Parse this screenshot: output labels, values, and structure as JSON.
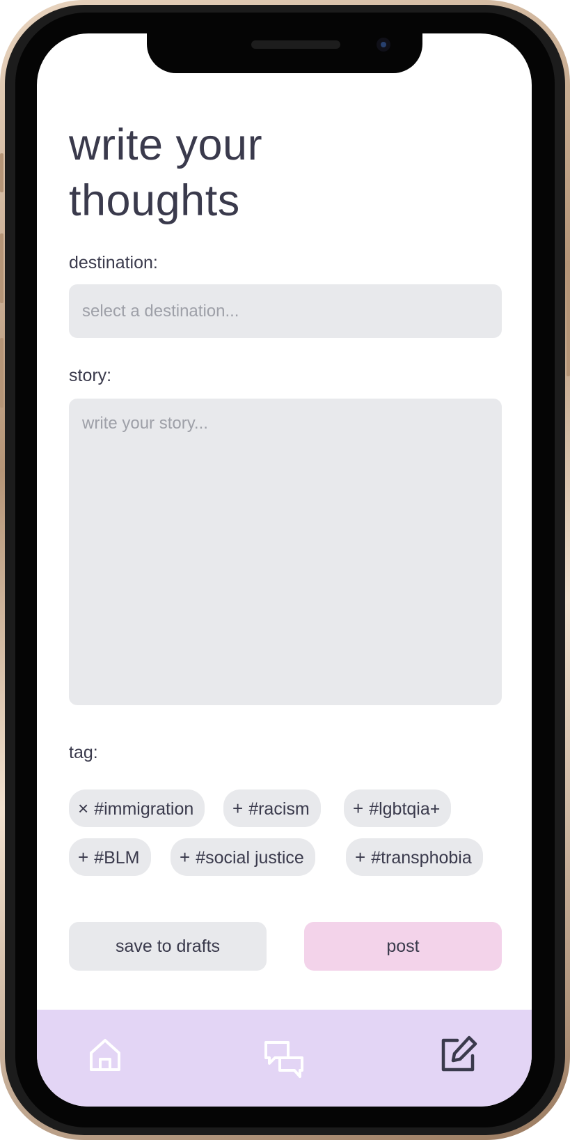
{
  "page": {
    "title_line1": "write your",
    "title_line2": "thoughts"
  },
  "destination": {
    "label": "destination:",
    "placeholder": "select a destination..."
  },
  "story": {
    "label": "story:",
    "placeholder": "write your story..."
  },
  "tags": {
    "label": "tag:",
    "items": [
      {
        "icon": "×",
        "icon_name": "remove-icon",
        "label": "#immigration",
        "selected": true
      },
      {
        "icon": "+",
        "icon_name": "add-icon",
        "label": "#racism",
        "selected": false
      },
      {
        "icon": "+",
        "icon_name": "add-icon",
        "label": "#lgbtqia+",
        "selected": false
      },
      {
        "icon": "+",
        "icon_name": "add-icon",
        "label": "#BLM",
        "selected": false
      },
      {
        "icon": "+",
        "icon_name": "add-icon",
        "label": "#social justice",
        "selected": false
      },
      {
        "icon": "+",
        "icon_name": "add-icon",
        "label": "#transphobia",
        "selected": false
      }
    ]
  },
  "actions": {
    "save_label": "save to drafts",
    "post_label": "post"
  },
  "nav": {
    "items": [
      {
        "icon": "home-icon"
      },
      {
        "icon": "chat-bubbles-icon"
      },
      {
        "icon": "compose-icon"
      }
    ]
  },
  "colors": {
    "text": "#3a3a4c",
    "field_bg": "#e8e9ec",
    "placeholder": "#9ea0a8",
    "post_bg": "#f3d3ea",
    "nav_bg": "#e3d5f5",
    "nav_icon": "#3a3a4c"
  }
}
